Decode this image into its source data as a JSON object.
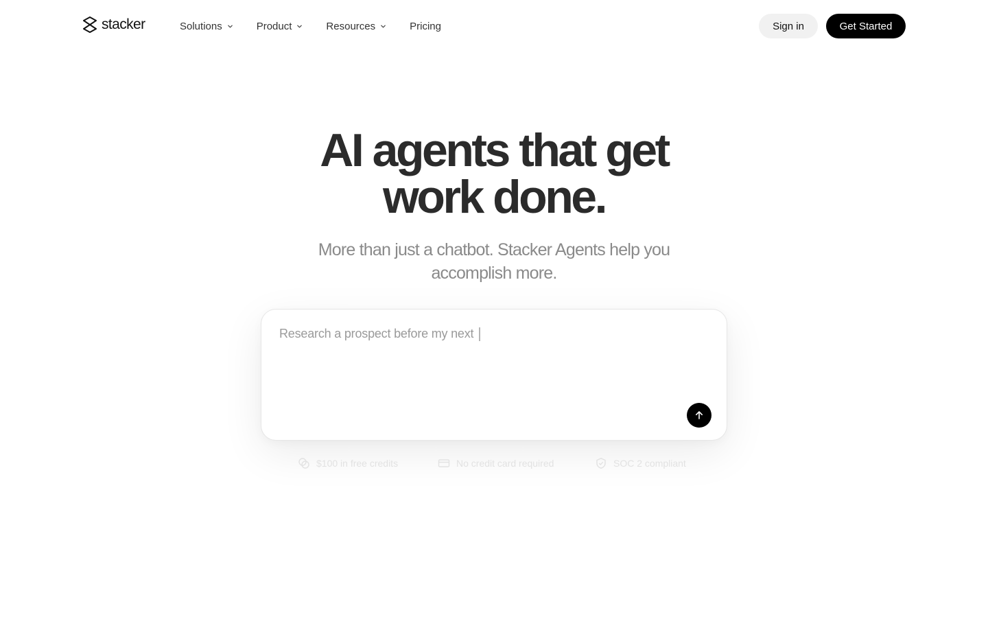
{
  "nav": {
    "logo_text": "stacker",
    "links": [
      {
        "label": "Solutions",
        "has_dropdown": true,
        "icon": "chevron-down-icon"
      },
      {
        "label": "Product",
        "has_dropdown": true,
        "icon": "chevron-down-icon"
      },
      {
        "label": "Resources",
        "has_dropdown": true,
        "icon": "chevron-down-icon"
      },
      {
        "label": "Pricing",
        "has_dropdown": false
      }
    ],
    "signin_label": "Sign in",
    "get_started_label": "Get Started"
  },
  "hero": {
    "title_line1": "AI agents that get",
    "title_line2": "work done.",
    "subtitle_line1": "More than just a chatbot. Stacker Agents help you",
    "subtitle_line2": "accomplish more."
  },
  "prompt": {
    "typed_text": "Research a prospect before my next",
    "send_icon": "arrow-up-icon"
  },
  "badges": [
    {
      "label": "$100 in free credits",
      "icon": "coins-icon"
    },
    {
      "label": "No credit card required",
      "icon": "credit-card-icon"
    },
    {
      "label": "SOC 2 compliant",
      "icon": "shield-check-icon"
    }
  ],
  "colors": {
    "primary_button": "#000000",
    "secondary_button": "#f1f1f1",
    "title": "#2b2b2b",
    "subtitle": "#8a8a8a",
    "placeholder": "#9a9a9a"
  }
}
